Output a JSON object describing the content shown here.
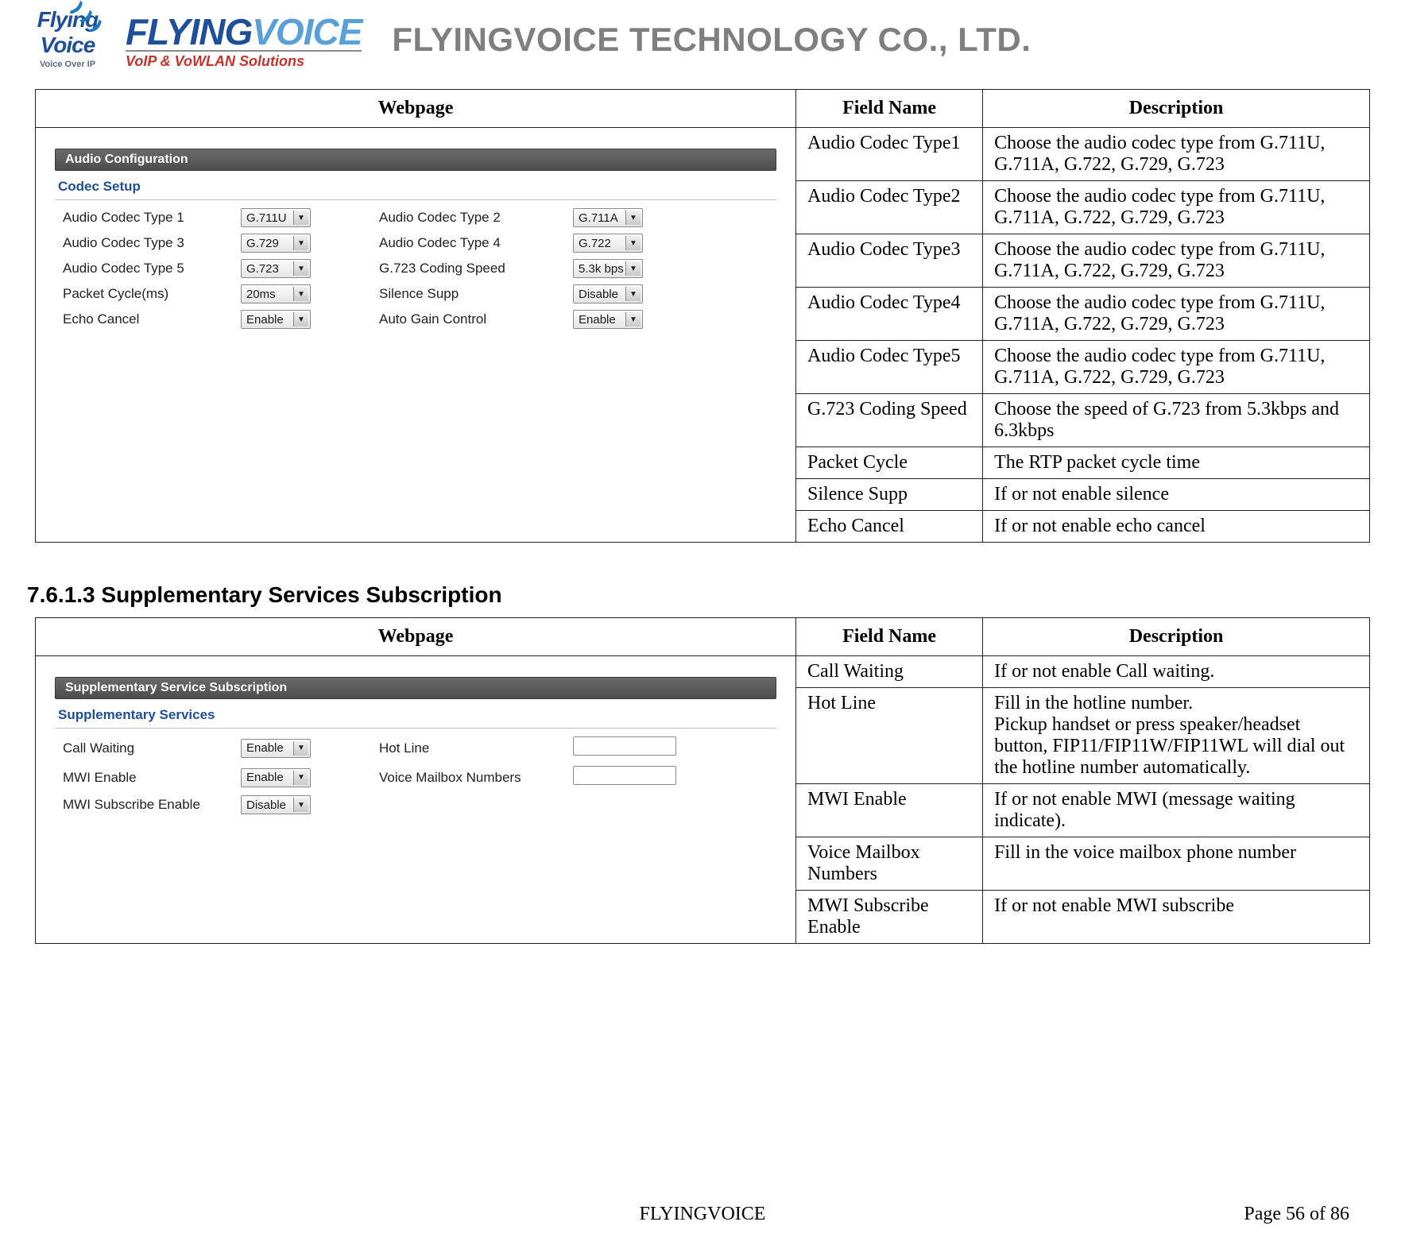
{
  "header": {
    "badge_line1": "Flying",
    "badge_line2": "Voice",
    "badge_line3": "Voice Over IP",
    "wordmark_flying": "FLYING",
    "wordmark_voice": "VOICE",
    "wordmark_sub": "VoIP & VoWLAN Solutions",
    "company": "FLYINGVOICE TECHNOLOGY CO., LTD."
  },
  "audio_table": {
    "headers": {
      "webpage": "Webpage",
      "field": "Field Name",
      "desc": "Description"
    },
    "panel": {
      "title": "Audio Configuration",
      "section": "Codec Setup",
      "rows": [
        {
          "l1": "Audio Codec Type 1",
          "v1": "G.711U",
          "l2": "Audio Codec Type 2",
          "v2": "G.711A",
          "t2": "select"
        },
        {
          "l1": "Audio Codec Type 3",
          "v1": "G.729",
          "l2": "Audio Codec Type 4",
          "v2": "G.722",
          "t2": "select"
        },
        {
          "l1": "Audio Codec Type 5",
          "v1": "G.723",
          "l2": "G.723 Coding Speed",
          "v2": "5.3k bps",
          "t2": "select"
        },
        {
          "l1": "Packet Cycle(ms)",
          "v1": "20ms",
          "l2": "Silence Supp",
          "v2": "Disable",
          "t2": "select"
        },
        {
          "l1": "Echo Cancel",
          "v1": "Enable",
          "l2": "Auto Gain Control",
          "v2": "Enable",
          "t2": "select"
        }
      ]
    },
    "fields": [
      {
        "name": "Audio Codec Type1",
        "desc": "Choose the audio codec type from G.711U, G.711A, G.722, G.729, G.723"
      },
      {
        "name": "Audio Codec Type2",
        "desc": "Choose the audio codec type from G.711U, G.711A, G.722, G.729, G.723"
      },
      {
        "name": "Audio Codec Type3",
        "desc": "Choose the audio codec type from G.711U, G.711A, G.722, G.729, G.723"
      },
      {
        "name": "Audio Codec Type4",
        "desc": "Choose the audio codec type from G.711U, G.711A, G.722, G.729, G.723"
      },
      {
        "name": "Audio Codec Type5",
        "desc": "Choose the audio codec type from G.711U, G.711A, G.722, G.729, G.723"
      },
      {
        "name": "G.723 Coding Speed",
        "desc": "Choose the speed of G.723 from 5.3kbps and 6.3kbps"
      },
      {
        "name": "Packet Cycle",
        "desc": "The RTP packet cycle time"
      },
      {
        "name": "Silence Supp",
        "desc": "If or not enable silence"
      },
      {
        "name": "Echo Cancel",
        "desc": "If or not enable echo cancel"
      }
    ]
  },
  "section_heading": "7.6.1.3  Supplementary Services Subscription",
  "supp_table": {
    "headers": {
      "webpage": "Webpage",
      "field": "Field Name",
      "desc": "Description"
    },
    "panel": {
      "title": "Supplementary Service Subscription",
      "section": "Supplementary Services",
      "rows": [
        {
          "l1": "Call Waiting",
          "v1": "Enable",
          "t1": "select",
          "l2": "Hot Line",
          "v2": "",
          "t2": "input"
        },
        {
          "l1": "MWI Enable",
          "v1": "Enable",
          "t1": "select",
          "l2": "Voice Mailbox Numbers",
          "v2": "",
          "t2": "input"
        },
        {
          "l1": "MWI Subscribe Enable",
          "v1": "Disable",
          "t1": "select",
          "l2": "",
          "v2": "",
          "t2": "none"
        }
      ]
    },
    "fields": [
      {
        "name": "Call Waiting",
        "desc": "If or not enable Call waiting."
      },
      {
        "name": "Hot Line",
        "desc": "Fill in the hotline number.\nPickup handset or press speaker/headset button, FIP11/FIP11W/FIP11WL will dial out the hotline number automatically."
      },
      {
        "name": "MWI Enable",
        "desc": "If or not enable MWI (message waiting indicate)."
      },
      {
        "name": "Voice Mailbox Numbers",
        "desc": "Fill in the voice mailbox phone number"
      },
      {
        "name": "MWI Subscribe Enable",
        "desc": "If or not enable MWI subscribe"
      }
    ]
  },
  "footer": {
    "center": "FLYINGVOICE",
    "right": "Page  56  of  86"
  }
}
